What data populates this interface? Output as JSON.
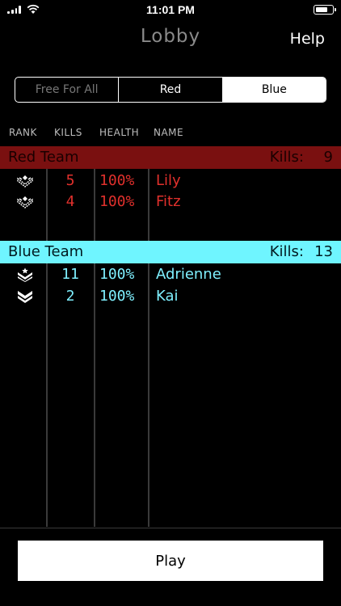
{
  "status_bar": {
    "time": "11:01 PM"
  },
  "header": {
    "title": "Lobby",
    "help_label": "Help"
  },
  "mode_tabs": [
    {
      "label": "Free For All"
    },
    {
      "label": "Red"
    },
    {
      "label": "Blue"
    }
  ],
  "columns": {
    "rank": "RANK",
    "kills": "KILLS",
    "health": "HEALTH",
    "name": "NAME"
  },
  "teams": {
    "red": {
      "name": "Red Team",
      "kills_label": "Kills:",
      "kills": "9",
      "color": "#7a1010",
      "text_color": "#e0302c",
      "players": [
        {
          "rank_icon": "rank-chevron-wings-icon",
          "kills": "5",
          "health": "100%",
          "name": "Lily"
        },
        {
          "rank_icon": "rank-chevron-wings-icon",
          "kills": "4",
          "health": "100%",
          "name": "Fitz"
        }
      ]
    },
    "blue": {
      "name": "Blue Team",
      "kills_label": "Kills:",
      "kills": "13",
      "color": "#6ff5ff",
      "text_color": "#7ff0ff",
      "players": [
        {
          "rank_icon": "rank-star-chevrons-icon",
          "kills": "11",
          "health": "100%",
          "name": "Adrienne"
        },
        {
          "rank_icon": "rank-double-chevron-icon",
          "kills": "2",
          "health": "100%",
          "name": "Kai"
        }
      ]
    }
  },
  "play_label": "Play"
}
